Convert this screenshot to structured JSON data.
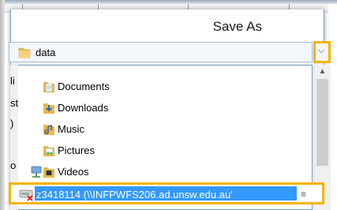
{
  "dialog": {
    "title": "Save As",
    "location_combo": {
      "value": "data",
      "dropdown_icon": "chevron-down-icon"
    },
    "dropdown_items": [
      {
        "label": "Documents",
        "icon": "documents-folder-icon"
      },
      {
        "label": "Downloads",
        "icon": "downloads-folder-icon"
      },
      {
        "label": "Music",
        "icon": "music-folder-icon"
      },
      {
        "label": "Pictures",
        "icon": "pictures-folder-icon"
      },
      {
        "label": "Videos",
        "icon": "videos-folder-icon"
      }
    ],
    "selected_item": {
      "label": "z3418114 (\\\\INFPWFS206.ad.unsw.edu.au'",
      "icon": "disconnected-network-drive-icon"
    },
    "left_fragments": [
      "li",
      "st",
      ")",
      "o"
    ]
  },
  "colors": {
    "highlight": "#f6b200",
    "selection": "#3399ff",
    "folder": "#e8b84a"
  }
}
